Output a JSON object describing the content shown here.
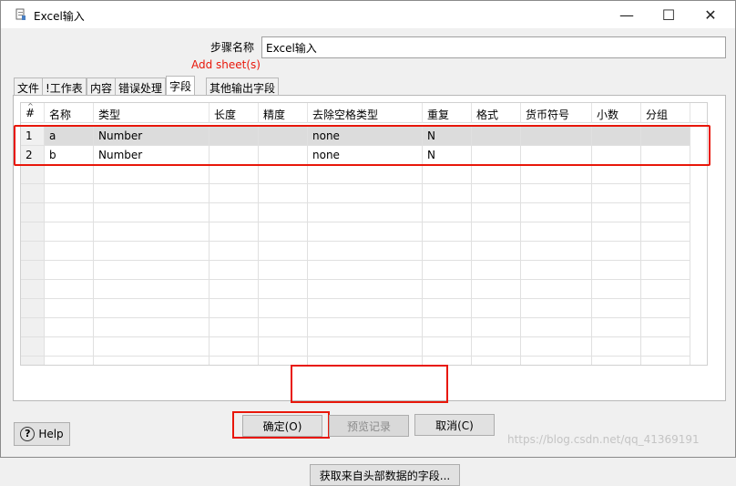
{
  "window": {
    "title": "Excel输入",
    "minimize": "—",
    "maximize": "☐",
    "close": "✕"
  },
  "step": {
    "label": "步骤名称",
    "value": "Excel输入"
  },
  "add_sheet_link": "Add sheet(s)",
  "tabs": [
    {
      "label": "文件"
    },
    {
      "label": "!工作表"
    },
    {
      "label": "内容"
    },
    {
      "label": "错误处理"
    },
    {
      "label": "字段",
      "active": true
    },
    {
      "label": "其他输出字段"
    }
  ],
  "table": {
    "columns": [
      "#",
      "名称",
      "类型",
      "长度",
      "精度",
      "去除空格类型",
      "重复",
      "格式",
      "货币符号",
      "小数",
      "分组"
    ],
    "rows": [
      [
        "1",
        "a",
        "Number",
        "",
        "",
        "none",
        "N",
        "",
        "",
        "",
        ""
      ],
      [
        "2",
        "b",
        "Number",
        "",
        "",
        "none",
        "N",
        "",
        "",
        "",
        ""
      ]
    ]
  },
  "buttons": {
    "get_fields": "获取来自头部数据的字段...",
    "ok": "确定(O)",
    "preview": "预览记录",
    "cancel": "取消(C)",
    "help": "Help"
  },
  "watermark": "https://blog.csdn.net/qq_41369191",
  "colors": {
    "highlight": "#e8170a",
    "selected_row": "#dcdcdc"
  }
}
